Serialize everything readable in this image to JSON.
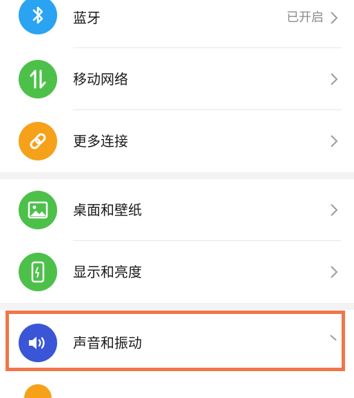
{
  "colors": {
    "bluetooth": "#2aa3f2",
    "mobile_network": "#4dc04a",
    "more_connections": "#f6a11a",
    "wallpaper": "#4dc04a",
    "display": "#4dc04a",
    "sound": "#3a56d6",
    "highlight": "#f0764a"
  },
  "groups": [
    {
      "items": [
        {
          "label": "蓝牙",
          "value": "已开启",
          "icon": "bluetooth-icon"
        },
        {
          "label": "移动网络",
          "icon": "mobile-data-arrows-icon"
        },
        {
          "label": "更多连接",
          "icon": "link-icon"
        }
      ]
    },
    {
      "items": [
        {
          "label": "桌面和壁纸",
          "icon": "image-icon"
        },
        {
          "label": "显示和亮度",
          "icon": "phone-brightness-icon"
        }
      ]
    },
    {
      "items": [
        {
          "label": "声音和振动",
          "icon": "speaker-icon",
          "highlighted": true
        }
      ]
    }
  ]
}
